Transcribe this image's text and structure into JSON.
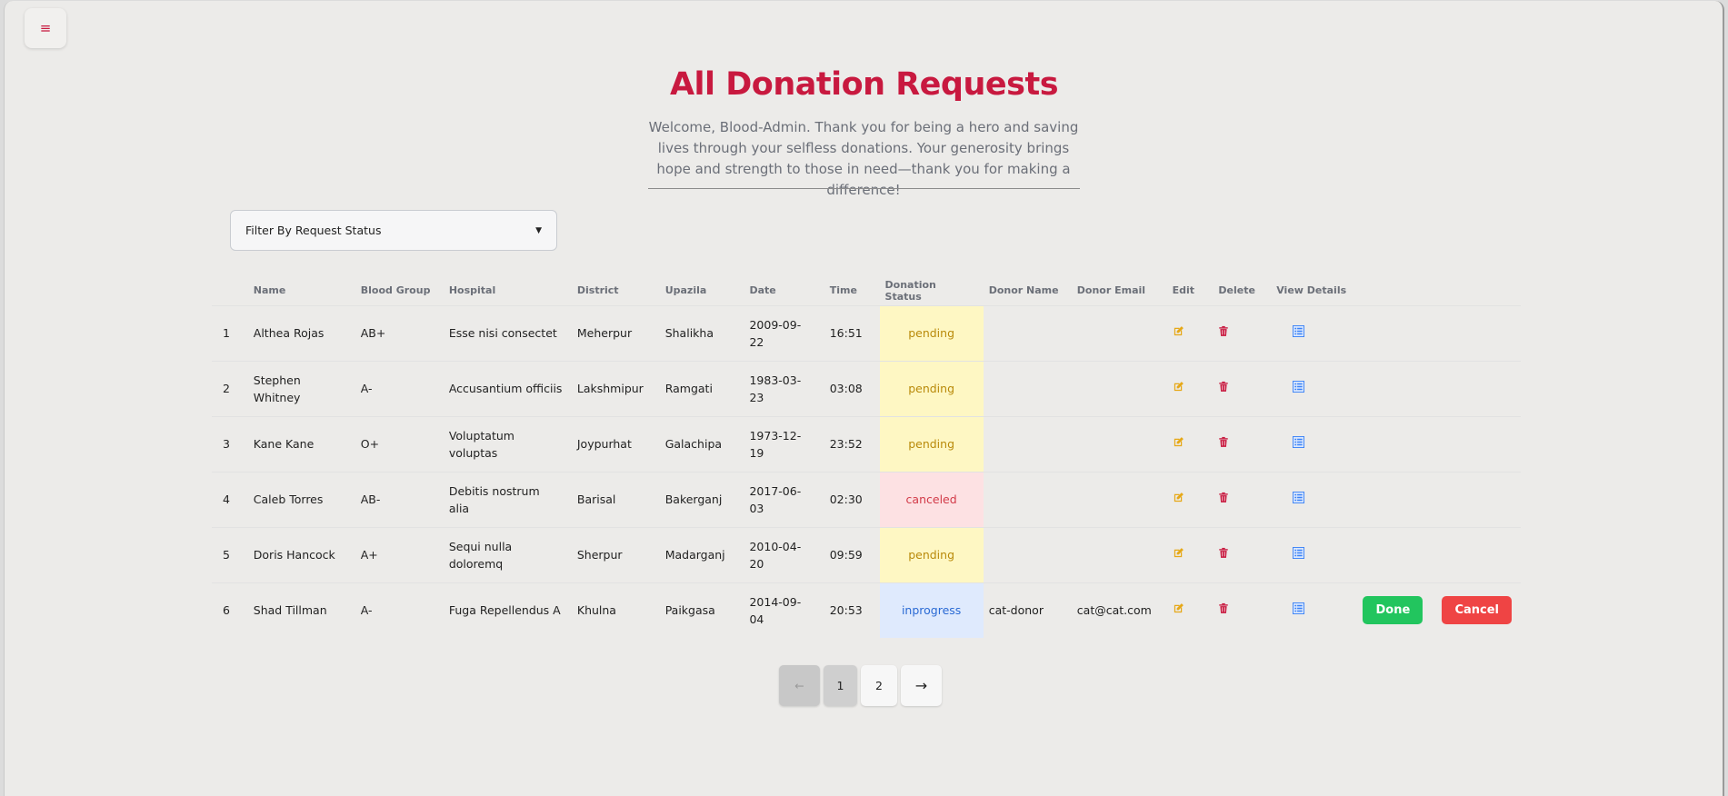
{
  "page": {
    "title": "All Donation Requests",
    "subtitle": "Welcome, Blood-Admin. Thank you for being a hero and saving lives through your selfless donations. Your generosity brings hope and strength to those in need—thank you for making a difference!"
  },
  "filter": {
    "label": "Filter By Request Status"
  },
  "table": {
    "headers": [
      "",
      "Name",
      "Blood Group",
      "Hospital",
      "District",
      "Upazila",
      "Date",
      "Time",
      "Donation Status",
      "Donor Name",
      "Donor Email",
      "Edit",
      "Delete",
      "View Details",
      "",
      ""
    ],
    "rows": [
      {
        "no": "1",
        "name": "Althea Rojas",
        "blood": "AB+",
        "hospital": "Esse nisi consectet",
        "district": "Meherpur",
        "upazila": "Shalikha",
        "date": "2009-09-22",
        "time": "16:51",
        "status": "pending",
        "donor_name": "",
        "donor_email": ""
      },
      {
        "no": "2",
        "name": "Stephen Whitney",
        "blood": "A-",
        "hospital": "Accusantium officiis",
        "district": "Lakshmipur",
        "upazila": "Ramgati",
        "date": "1983-03-23",
        "time": "03:08",
        "status": "pending",
        "donor_name": "",
        "donor_email": ""
      },
      {
        "no": "3",
        "name": "Kane Kane",
        "blood": "O+",
        "hospital": "Voluptatum voluptas",
        "district": "Joypurhat",
        "upazila": "Galachipa",
        "date": "1973-12-19",
        "time": "23:52",
        "status": "pending",
        "donor_name": "",
        "donor_email": ""
      },
      {
        "no": "4",
        "name": "Caleb Torres",
        "blood": "AB-",
        "hospital": "Debitis nostrum alia",
        "district": "Barisal",
        "upazila": "Bakerganj",
        "date": "2017-06-03",
        "time": "02:30",
        "status": "canceled",
        "donor_name": "",
        "donor_email": ""
      },
      {
        "no": "5",
        "name": "Doris Hancock",
        "blood": "A+",
        "hospital": "Sequi nulla doloremq",
        "district": "Sherpur",
        "upazila": "Madarganj",
        "date": "2010-04-20",
        "time": "09:59",
        "status": "pending",
        "donor_name": "",
        "donor_email": ""
      },
      {
        "no": "6",
        "name": "Shad Tillman",
        "blood": "A-",
        "hospital": "Fuga Repellendus A",
        "district": "Khulna",
        "upazila": "Paikgasa",
        "date": "2014-09-04",
        "time": "20:53",
        "status": "inprogress",
        "donor_name": "cat-donor",
        "donor_email": "cat@cat.com",
        "actions": {
          "done": "Done",
          "cancel": "Cancel"
        }
      }
    ]
  },
  "pagination": {
    "pages": [
      "1",
      "2"
    ],
    "current": "1"
  },
  "icons": {
    "menu": "menu-icon",
    "edit": "edit-icon",
    "delete": "trash-icon",
    "details": "list-icon",
    "prev": "arrow-left-icon",
    "next": "arrow-right-icon",
    "caret": "caret-down-icon"
  },
  "colors": {
    "accent": "#c8193f",
    "edit": "#e6a817",
    "delete": "#c8193f",
    "details": "#3b82f6",
    "done": "#22c55e",
    "cancel": "#ef4444"
  }
}
